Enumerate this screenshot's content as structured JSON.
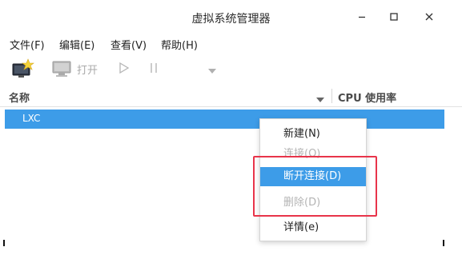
{
  "window": {
    "title": "虚拟系统管理器"
  },
  "menubar": {
    "items": [
      "文件(F)",
      "编辑(E)",
      "查看(V)",
      "帮助(H)"
    ]
  },
  "toolbar": {
    "open_label": "打开",
    "icons": [
      "new-vm-icon",
      "monitor-icon",
      "play-icon",
      "pause-icon",
      "chevron-down-icon"
    ]
  },
  "list": {
    "columns": [
      "名称",
      "CPU 使用率"
    ],
    "rows": [
      {
        "name": "LXC",
        "selected": true
      }
    ]
  },
  "context_menu": {
    "items": [
      {
        "label": "新建(N)",
        "enabled": true
      },
      {
        "label": "连接(O)",
        "enabled": false
      },
      {
        "label": "断开连接(D)",
        "enabled": true,
        "active": true
      },
      {
        "label": "删除(D)",
        "enabled": false
      },
      {
        "label": "详情(e)",
        "enabled": true
      }
    ]
  },
  "colors": {
    "selection": "#3d9ce8",
    "highlight_box": "#e8344a"
  }
}
